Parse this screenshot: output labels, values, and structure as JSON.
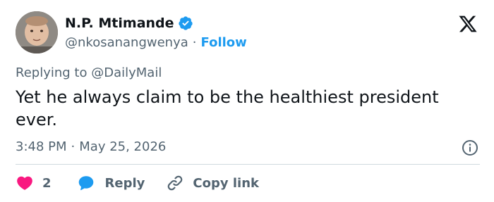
{
  "author": {
    "display_name": "N.P. Mtimande",
    "handle": "@nkosanangwenya",
    "separator": "·",
    "follow_label": "Follow",
    "verified": true
  },
  "icons": {
    "avatar": "profile-photo",
    "verified": "verified-badge-icon",
    "logo": "x-logo-icon",
    "info": "info-icon",
    "like": "heart-icon",
    "reply": "speech-bubble-icon",
    "copy": "link-icon"
  },
  "reply_context": {
    "prefix": "Replying to",
    "mention": "@DailyMail"
  },
  "tweet": {
    "text": "Yet he always claim to be the healthiest president ever."
  },
  "meta": {
    "time": "3:48 PM",
    "separator": "·",
    "date": "May 25, 2026"
  },
  "actions": {
    "like_count": "2",
    "reply_label": "Reply",
    "copy_label": "Copy link"
  },
  "colors": {
    "accent": "#1d9bf0",
    "like": "#f91880",
    "text": "#0f1419",
    "secondary": "#536471",
    "divider": "#cfd9de"
  }
}
